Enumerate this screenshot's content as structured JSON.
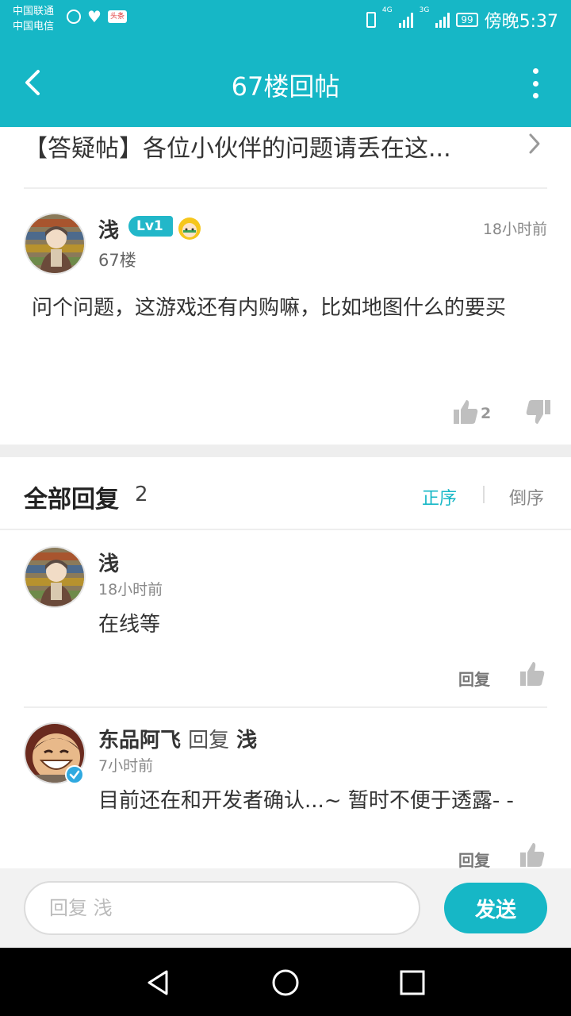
{
  "status_bar": {
    "carrier1": "中国联通",
    "carrier2": "中国电信",
    "news_badge": "头条",
    "net1": "4G",
    "net2": "3G",
    "battery": "99",
    "time": "傍晚5:37"
  },
  "header": {
    "title": "67楼回帖",
    "back_icon": "chevron-left-icon",
    "menu_icon": "more-vertical-icon"
  },
  "thread": {
    "title": "【答疑帖】各位小伙伴的问题请丢在这..."
  },
  "post": {
    "author": "浅",
    "level": "Lv1",
    "time": "18小时前",
    "floor": "67楼",
    "content": "问个问题，这游戏还有内购嘛，比如地图什么的要买",
    "likes": "2"
  },
  "replies_header": {
    "title": "全部回复",
    "count": "2",
    "sort_asc": "正序",
    "sort_desc": "倒序"
  },
  "replies": [
    {
      "author": "浅",
      "time": "18小时前",
      "content": "在线等",
      "reply_label": "回复"
    },
    {
      "author": "东品阿飞",
      "reply_verb": "回复",
      "reply_to": "浅",
      "time": "7小时前",
      "content": "目前还在和开发者确认...~ 暂时不便于透露- -",
      "reply_label": "回复"
    }
  ],
  "input_bar": {
    "placeholder": "回复 浅",
    "send_label": "发送"
  },
  "colors": {
    "accent": "#16b7c6",
    "background": "#ffffff",
    "divider": "#eeeeee"
  }
}
